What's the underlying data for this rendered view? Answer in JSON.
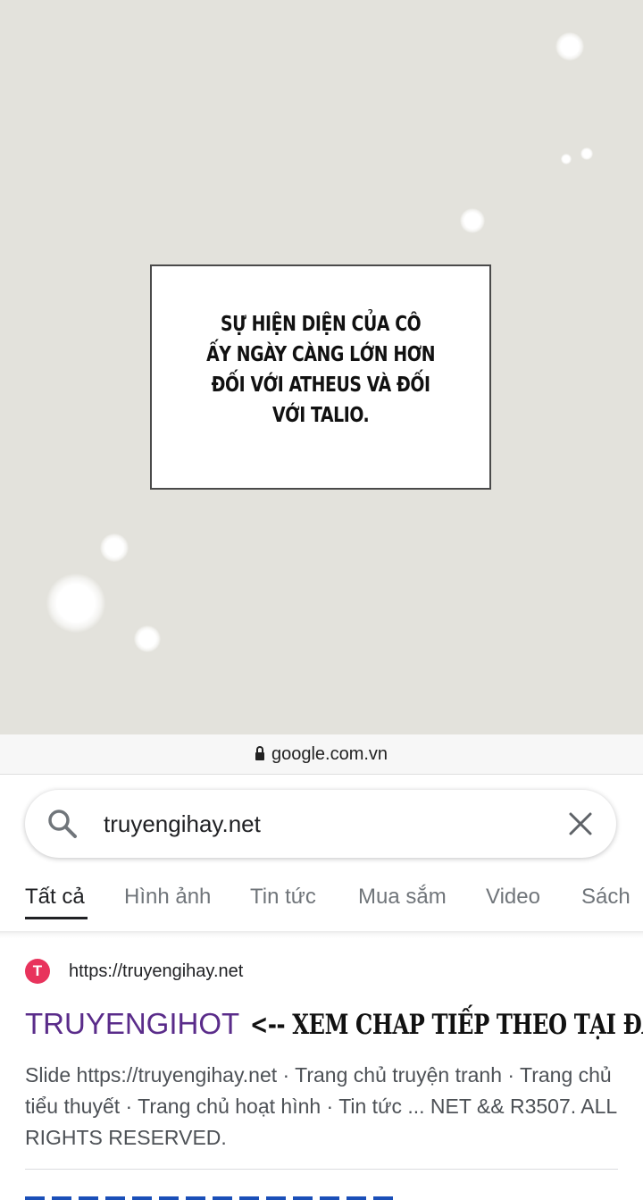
{
  "comic": {
    "caption_lines": [
      "SỰ HIỆN DIỆN CỦA CÔ",
      "ẤY NGÀY CÀNG LỚN HƠN",
      "ĐỐI VỚI ATHEUS VÀ ĐỐI",
      "VỚI TALIO."
    ]
  },
  "browser": {
    "url": "google.com.vn",
    "icon": "lock-icon"
  },
  "search": {
    "value": "truyengihay.net",
    "icons": [
      "search-icon",
      "clear-icon"
    ]
  },
  "tabs": [
    {
      "label": "Tất cả",
      "active": true
    },
    {
      "label": "Hình ảnh"
    },
    {
      "label": "Tin tức"
    },
    {
      "label": "Mua sắm"
    },
    {
      "label": "Video"
    },
    {
      "label": "Sách"
    }
  ],
  "result": {
    "favicon_letter": "T",
    "url": "https://truyengihay.net",
    "title_brand": "TRUYENGIHOT",
    "title_cta": "<-- XEM CHAP TIẾP THEO TẠI ĐÂY",
    "snippet": "Slide https://truyengihay.net · Trang chủ truyện tranh · Trang chủ tiểu thuyết · Trang chủ hoạt hình · Tin tức ... NET && R3507. ALL RIGHTS RESERVED."
  },
  "colors": {
    "comic_bg": "#e3e2dc",
    "brand_purple": "#5a2c8a",
    "favicon_red": "#e8335c"
  }
}
